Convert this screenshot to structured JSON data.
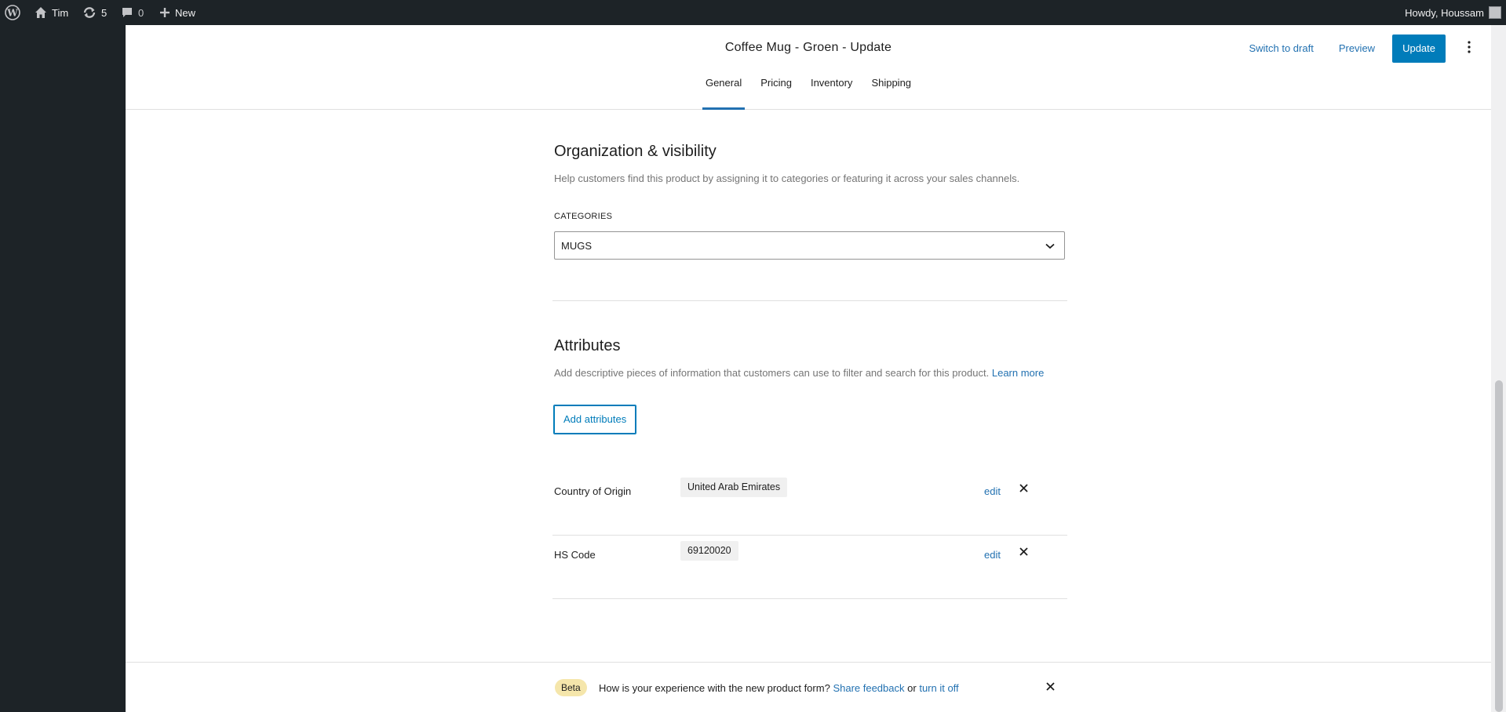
{
  "adminbar": {
    "site_name": "Tim",
    "updates_count": "5",
    "comments_count": "0",
    "new_label": "New",
    "howdy": "Howdy, Houssam"
  },
  "header": {
    "title": "Coffee Mug - Groen - Update",
    "tabs": [
      {
        "label": "General",
        "active": true
      },
      {
        "label": "Pricing",
        "active": false
      },
      {
        "label": "Inventory",
        "active": false
      },
      {
        "label": "Shipping",
        "active": false
      }
    ],
    "switch_to_draft": "Switch to draft",
    "preview": "Preview",
    "update": "Update"
  },
  "organization": {
    "title": "Organization & visibility",
    "description": "Help customers find this product by assigning it to categories or featuring it across your sales channels.",
    "categories_label": "CATEGORIES",
    "categories_value": "MUGS"
  },
  "attributes": {
    "title": "Attributes",
    "description": "Add descriptive pieces of information that customers can use to filter and search for this product.",
    "learn_more": "Learn more",
    "add_button": "Add attributes",
    "items": [
      {
        "name": "Country of Origin",
        "value": "United Arab Emirates",
        "edit": "edit"
      },
      {
        "name": "HS Code",
        "value": "69120020",
        "edit": "edit"
      }
    ]
  },
  "footer": {
    "badge": "Beta",
    "question": "How is your experience with the new product form?",
    "share_feedback": "Share feedback",
    "or": "or",
    "turn_off": "turn it off"
  },
  "colors": {
    "accent": "#007cba",
    "link": "#2271b1",
    "annotation_arrow": "#e02020",
    "beta_badge": "#f5e6ab"
  },
  "icons": [
    "wordpress-icon",
    "home-icon",
    "updates-icon",
    "comment-icon",
    "plus-icon",
    "kebab-menu-icon",
    "chevron-down-icon",
    "close-icon",
    "up-arrow-annotation"
  ]
}
